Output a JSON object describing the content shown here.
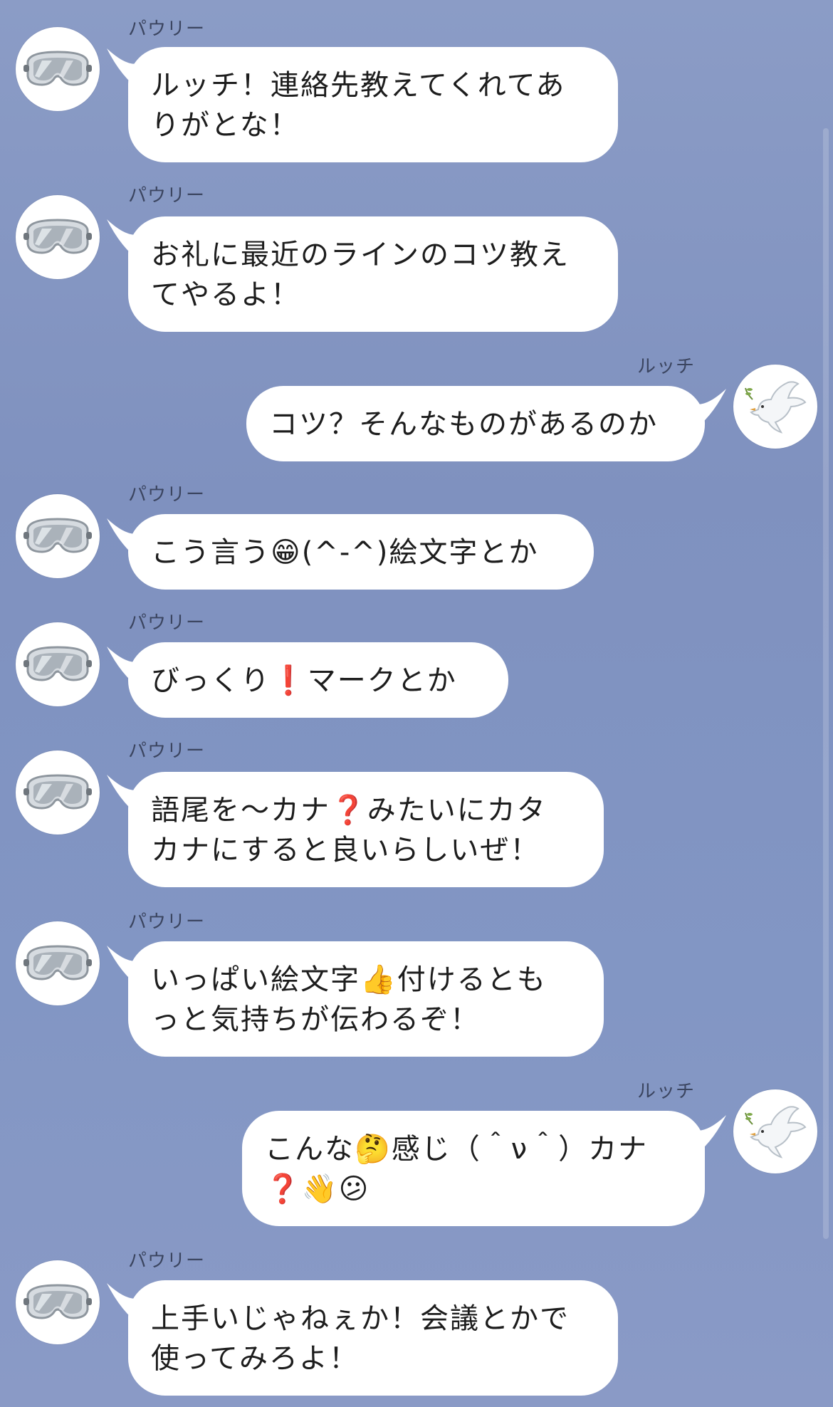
{
  "messages": [
    {
      "sender": "パウリー",
      "side": "left",
      "text": "ルッチ！連絡先教えてくれてあ\nりがとな！"
    },
    {
      "sender": "パウリー",
      "side": "left",
      "text": "お礼に最近のラインのコツ教え\nてやるよ！"
    },
    {
      "sender": "ルッチ",
      "side": "right",
      "text": "コツ？そんなものがあるのか"
    },
    {
      "sender": "パウリー",
      "side": "left",
      "text": "こう言う😁(^-^)絵文字とか"
    },
    {
      "sender": "パウリー",
      "side": "left",
      "text": "びっくり❗️マークとか"
    },
    {
      "sender": "パウリー",
      "side": "left",
      "text": "語尾を〜カナ❓みたいにカタ\nカナにすると良いらしいぜ！"
    },
    {
      "sender": "パウリー",
      "side": "left",
      "text": "いっぱい絵文字👍付けるとも\nっと気持ちが伝わるぞ！"
    },
    {
      "sender": "ルッチ",
      "side": "right",
      "text": "こんな🤔感じ（＾ν＾）カナ\n❓👋😕"
    },
    {
      "sender": "パウリー",
      "side": "left",
      "text": "上手いじゃねぇか！会議とかで\n使ってみろよ！"
    }
  ],
  "avatars": {
    "left": "goggles-icon",
    "right": "dove-icon"
  },
  "colors": {
    "background": "#8597c3",
    "bubble": "#ffffff",
    "name_text": "#3b4560"
  }
}
